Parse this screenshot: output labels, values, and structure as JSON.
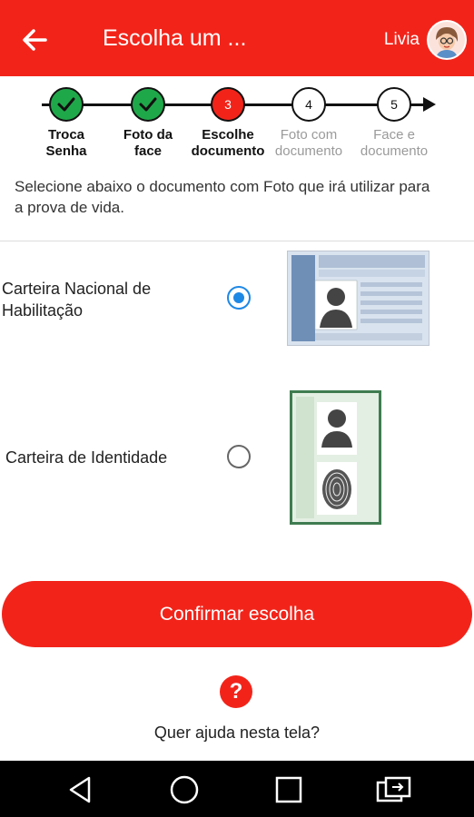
{
  "appbar": {
    "title": "Escolha um ...",
    "user_name": "Livia",
    "accent_color": "#f2241a"
  },
  "stepper": {
    "steps": [
      {
        "number": "",
        "label_line1": "Troca",
        "label_line2": "Senha",
        "state": "done",
        "icon": "check-icon"
      },
      {
        "number": "",
        "label_line1": "Foto da",
        "label_line2": "face",
        "state": "done",
        "icon": "check-icon"
      },
      {
        "number": "3",
        "label_line1": "Escolhe",
        "label_line2": "documento",
        "state": "current"
      },
      {
        "number": "4",
        "label_line1": "Foto com",
        "label_line2": "documento",
        "state": "todo"
      },
      {
        "number": "5",
        "label_line1": "Face e",
        "label_line2": "documento",
        "state": "todo"
      }
    ]
  },
  "intro": "Selecione abaixo o documento com Foto que irá utilizar para a prova de vida.",
  "options": [
    {
      "label_line1": "Carteira Nacional de",
      "label_line2": "Habilitação",
      "selected": true,
      "image": "drivers-license-image"
    },
    {
      "label_line1": "Carteira de Identidade",
      "label_line2": "",
      "selected": false,
      "image": "identity-card-image"
    }
  ],
  "confirm_label": "Confirmar escolha",
  "help": {
    "icon": "question-icon",
    "text": "Quer ajuda nesta tela?"
  },
  "navbar": {
    "icons": [
      "back-triangle-icon",
      "home-circle-icon",
      "recents-square-icon",
      "screen-rotate-icon"
    ]
  }
}
